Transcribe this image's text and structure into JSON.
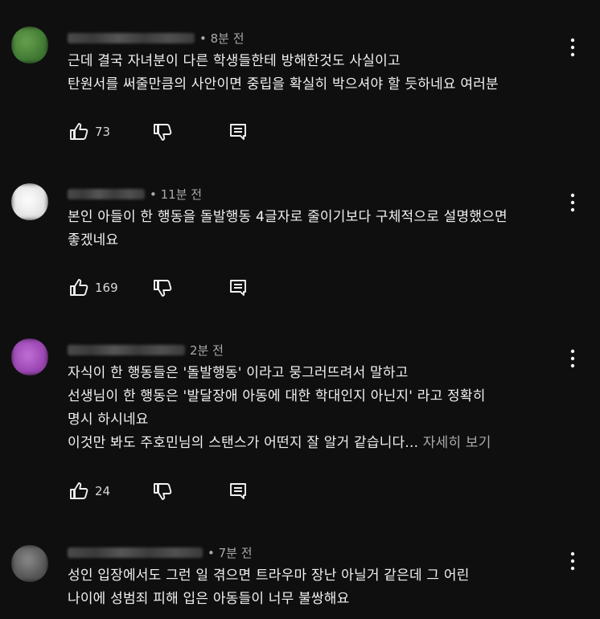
{
  "comments": [
    {
      "time": "• 8분 전",
      "lines": [
        "근데 결국 자녀분이 다른 학생들한테 방해한것도 사실이고",
        " 탄원서를 써줄만큼의 사안이면 중립을 확실히 박으셔야 할 듯하네요 여러분"
      ],
      "likes": "73",
      "avatar_color": "#4e8a3e"
    },
    {
      "time": "• 11분 전",
      "lines": [
        "본인 아들이 한 행동을 돌발행동 4글자로 줄이기보다 구체적으로 설명했으면",
        "좋겠네요"
      ],
      "likes": "169",
      "avatar_color": "#e6e6e6"
    },
    {
      "time": "2분 전",
      "lines": [
        "자식이 한 행동들은 '돌발행동' 이라고 뭉그러뜨려서 말하고",
        "선생님이 한 행동은 '발달장애 아동에 대한 학대인지 아닌지' 라고 정확히",
        "명시 하시네요",
        "이것만 봐도 주호민님의 스탠스가 어떤지 잘 알거 같습니다..."
      ],
      "more": " 자세히 보기",
      "likes": "24",
      "avatar_color": "#a24fb8"
    },
    {
      "time": "• 7분 전",
      "lines": [
        "성인 입장에서도 그런 일 겪으면 트라우마 장난 아닐거 같은데 그 어린",
        "나이에 성범죄 피해 입은 아동들이 너무 불쌍해요"
      ],
      "avatar_color": "#6d6d6d"
    }
  ]
}
